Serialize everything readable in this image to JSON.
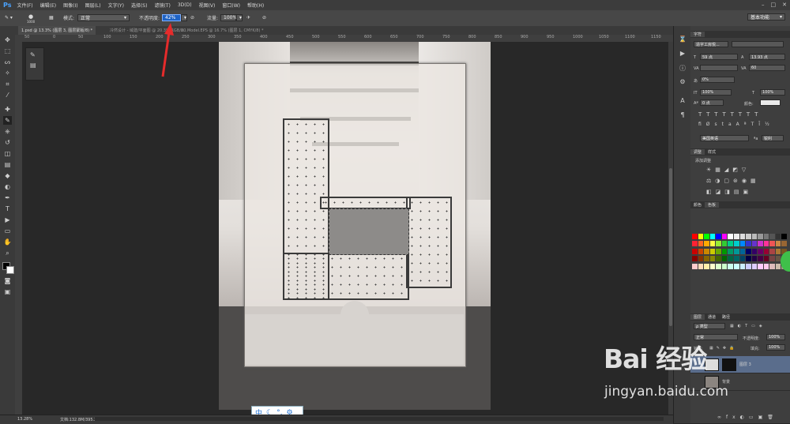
{
  "app": {
    "logo": "Ps"
  },
  "menu": [
    "文件(F)",
    "编辑(E)",
    "图像(I)",
    "图层(L)",
    "文字(Y)",
    "选择(S)",
    "滤镜(T)",
    "3D(D)",
    "视图(V)",
    "窗口(W)",
    "帮助(H)"
  ],
  "options_bar": {
    "brush_size": "1000",
    "mode_label": "模式:",
    "mode_value": "正常",
    "opacity_label": "不透明度:",
    "opacity_value": "42%",
    "flow_label": "流量:",
    "flow_value": "100%",
    "workspace": "基本功能"
  },
  "tabs": [
    {
      "label": "1.psd @ 13.3% (图层 3, 图层蒙版/8) *",
      "active": true
    },
    {
      "label": "冷然设计 - 域建/平面图 @ 20.3%/RGB/8...",
      "active": false
    },
    {
      "label": "20 Model.EPS @ 16.7% (图层 1, CMYK/8) *",
      "active": false
    }
  ],
  "ruler_labels": [
    "50",
    "0",
    "50",
    "100",
    "150",
    "200",
    "250",
    "300",
    "350",
    "400",
    "450",
    "500",
    "550",
    "600",
    "650",
    "700",
    "750",
    "800",
    "850",
    "900",
    "950",
    "1000",
    "1050",
    "1100",
    "1150"
  ],
  "status": {
    "zoom": "13.28%",
    "doc": "文档:132.8M/395.2M"
  },
  "ime": {
    "lang": "中"
  },
  "character_panel": {
    "tab": "字符",
    "font": "造字工房悦...",
    "size": "59 点",
    "leading": "13.93 点",
    "tracking": "60",
    "vscale": "0%",
    "scale_v": "100%",
    "scale_h": "100%",
    "baseline": "0 点",
    "color_label": "颜色:",
    "lang": "美国英语",
    "aa": "锐利"
  },
  "adjustments": {
    "tab1": "调整",
    "tab2": "样式",
    "title": "添加调整"
  },
  "color_tabs": {
    "tab1": "颜色",
    "tab2": "色板"
  },
  "layers_panel": {
    "tabs": [
      "图层",
      "通道",
      "路径"
    ],
    "kind": "ρ 类型",
    "blend": "正常",
    "opacity_label": "不透明度:",
    "opacity": "100%",
    "lock_label": "锁定:",
    "fill_label": "填充:",
    "fill": "100%",
    "layers": [
      {
        "name": "图层 3"
      },
      {
        "name": "背景"
      }
    ]
  },
  "watermark": {
    "brand": "Bai 经验",
    "url": "jingyan.baidu.com"
  }
}
